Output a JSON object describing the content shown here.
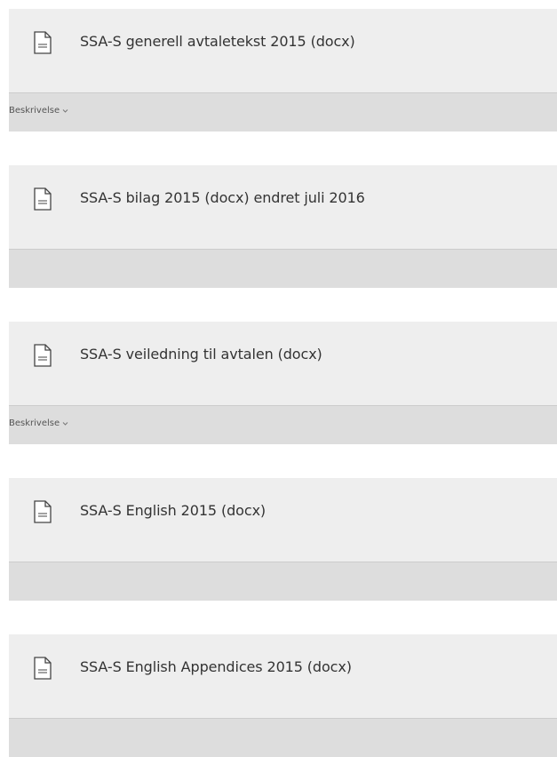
{
  "documents": [
    {
      "title": "SSA-S generell avtaletekst 2015 (docx)",
      "description_label": "Beskrivelse",
      "icon": "document-icon"
    },
    {
      "title": "SSA-S bilag 2015 (docx) endret juli 2016",
      "description_label": "",
      "icon": "document-icon"
    },
    {
      "title": "SSA-S veiledning til avtalen (docx)",
      "description_label": "Beskrivelse",
      "icon": "document-icon"
    },
    {
      "title": "SSA-S English 2015 (docx)",
      "description_label": "",
      "icon": "document-icon"
    },
    {
      "title": "SSA-S English Appendices 2015 (docx)",
      "description_label": "",
      "icon": "document-icon"
    }
  ],
  "colors": {
    "card_background": "#eeeeee",
    "footer_background": "#dddddd",
    "title_text": "#333333"
  }
}
